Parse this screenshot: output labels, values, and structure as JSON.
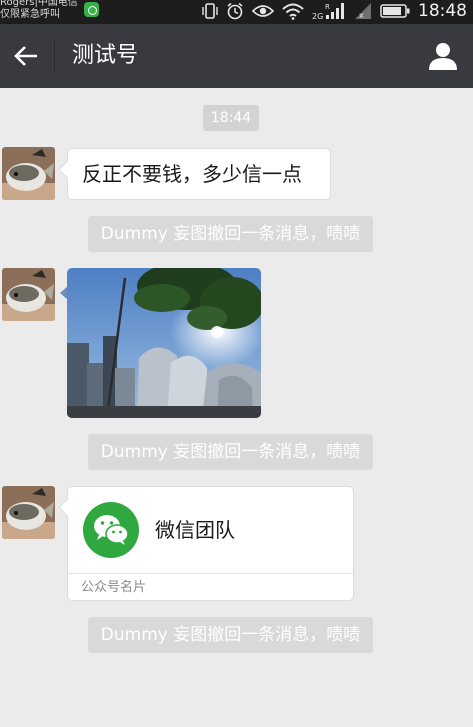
{
  "status_bar": {
    "carrier_line1": "Rogers|中国电信",
    "carrier_line2": "仅限紧急呼叫",
    "time": "18:48",
    "icons": [
      "app-badge-icon",
      "vibrate-icon",
      "alarm-icon",
      "eye-icon",
      "wifi-icon",
      "2g-signal-icon",
      "signal-x-icon",
      "battery-icon"
    ],
    "network_label": "2G"
  },
  "nav_bar": {
    "back_icon": "arrow-left-icon",
    "title": "测试号",
    "profile_icon": "person-icon"
  },
  "chat": {
    "timestamp": "18:44",
    "messages": [
      {
        "type": "text",
        "text": "反正不要钱，多少信一点"
      },
      {
        "type": "system",
        "text": "Dummy 妄图撤回一条消息，啧啧"
      },
      {
        "type": "image"
      },
      {
        "type": "system",
        "text": "Dummy 妄图撤回一条消息，啧啧"
      },
      {
        "type": "card",
        "title": "微信团队",
        "footer": "公众号名片"
      },
      {
        "type": "system",
        "text": "Dummy 妄图撤回一条消息，啧啧"
      }
    ]
  },
  "colors": {
    "nav_bg": "#393a3f",
    "status_bg": "#1d1d1d",
    "chat_bg": "#ebebeb",
    "wechat_green": "#2fa840"
  }
}
